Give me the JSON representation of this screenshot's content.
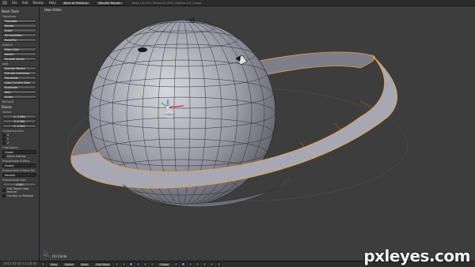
{
  "topbar": {
    "menus": [
      "File",
      "Add",
      "Render",
      "Help"
    ],
    "screen_button": "Back to Previous",
    "engine_button": "Blender Render",
    "stats": "Verts:1/1,331 | Faces:0/1,326 | Objects:1/3 | Lamp"
  },
  "toolshelf": {
    "title": "Mesh Tools",
    "transform_label": "Transform",
    "transform_items": [
      "Translate",
      "Rotate",
      "Scale",
      "Shrink/Fatten",
      "Push/Pull"
    ],
    "deform_label": "Deform",
    "deform_items": [
      "Edge Slide",
      "Vertex",
      "Smooth Vertex"
    ],
    "add_label": "Add",
    "add_items": [
      "Extrude Region",
      "Extrude Individual",
      "Subdivide",
      "Loop Cut and Slide",
      "Duplicate",
      "Spin",
      "Screw"
    ],
    "remove_label": "Remove",
    "resize_label": "Resize",
    "vector_label": "Vector",
    "vector_values": [
      "X: 0.960",
      "Y: 0.960",
      "Z: 0.960"
    ],
    "constraint_label": "Constraint Axis",
    "constraint_axes": [
      "X",
      "Y",
      "Z"
    ],
    "orientation_label": "Orientation",
    "orientation_value": "Global",
    "mirror_label": "Mirror Editing",
    "prop_edit_label": "Proportional Editing",
    "prop_edit_value": "Enable",
    "prop_falloff_label": "Proportional Editing Fall",
    "prop_falloff_value": "Smooth",
    "prop_size_label": "Proportional Size",
    "prop_size_value": "1.000",
    "edit_texture_label": "Edit Object data texture",
    "confirm_label": "Confirm on Release"
  },
  "viewport": {
    "view_label": "User Ortho",
    "object_label": "(1) Circle"
  },
  "bottombar": {
    "view": "View",
    "select": "Select",
    "mesh": "Mesh",
    "mode": "Edit Mode",
    "pivot": "Global"
  },
  "stamp": "2012-03-02 13:18:40",
  "watermark": "pxleyes.com",
  "colors": {
    "viewport_bg": "#3d3d3d",
    "panel_bg": "#3b3b3b",
    "mesh_face": "#9a9aa8",
    "selected_edge": "#f0a030"
  }
}
